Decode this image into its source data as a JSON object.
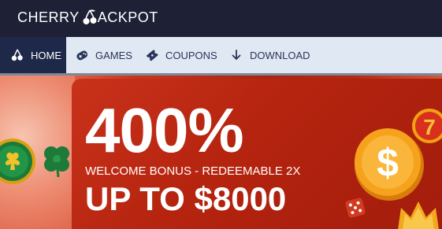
{
  "header": {
    "logo_left": "CHERRY",
    "logo_right": "ACKPOT"
  },
  "nav": {
    "items": [
      {
        "label": "HOME",
        "icon": "cherry-icon",
        "active": true
      },
      {
        "label": "GAMES",
        "icon": "gamepad-icon",
        "active": false
      },
      {
        "label": "COUPONS",
        "icon": "coupon-tag-icon",
        "active": false
      },
      {
        "label": "DOWNLOAD",
        "icon": "download-arrow-icon",
        "active": false
      }
    ]
  },
  "promo": {
    "headline": "400%",
    "subline": "WELCOME BONUS - REDEEMABLE 2X",
    "amount": "UP TO $8000"
  },
  "colors": {
    "header_bg": "#1e2035",
    "nav_bg": "#dfe8f3",
    "nav_active_bg": "#1e2849",
    "promo_red": "#b5240f",
    "coin_gold": "#f6a21c"
  }
}
